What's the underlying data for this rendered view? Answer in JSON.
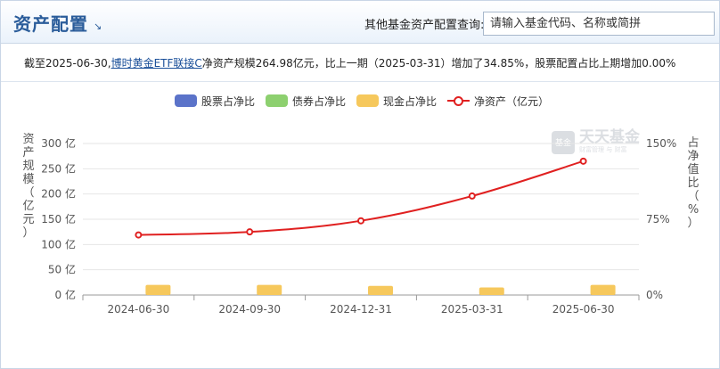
{
  "header": {
    "title": "资产配置",
    "title_arrow": "↘",
    "query_label": "其他基金资产配置查询:",
    "search_placeholder": "请输入基金代码、名称或简拼"
  },
  "summary": {
    "prefix": "截至2025-06-30,",
    "fund_link": "博时黄金ETF联接C",
    "suffix": "净资产规模264.98亿元，比上一期（2025-03-31）增加了34.85%，股票配置占比上期增加0.00%"
  },
  "watermark": {
    "logo": "基金",
    "name": "天天基金",
    "tagline": "财富管理 与 财富"
  },
  "colors": {
    "stock": "#5b73c9",
    "bond": "#8dd06f",
    "cash": "#f6c85c",
    "net_assets": "#e02020"
  },
  "chart_data": {
    "type": "bar",
    "legend": [
      "股票占净比",
      "债券占净比",
      "现金占净比",
      "净资产（亿元）"
    ],
    "legend_position": "top-center",
    "left_axis_label": [
      "资",
      "产",
      "规",
      "模",
      "（",
      "亿",
      "元",
      "）"
    ],
    "right_axis_label": [
      "占",
      "净",
      "值",
      "比",
      "（",
      "%",
      "）"
    ],
    "categories": [
      "2024-06-30",
      "2024-09-30",
      "2024-12-31",
      "2025-03-31",
      "2025-06-30"
    ],
    "left_ticks": [
      "0 亿",
      "50 亿",
      "100 亿",
      "150 亿",
      "200 亿",
      "250 亿",
      "300 亿"
    ],
    "right_ticks": [
      "0%",
      "75%",
      "150%"
    ],
    "ylim_left": [
      0,
      300
    ],
    "ylim_right": [
      0,
      150
    ],
    "series": [
      {
        "name": "股票占净比",
        "kind": "bar",
        "axis": "right",
        "values": [
          0,
          0,
          0,
          0,
          0
        ]
      },
      {
        "name": "债券占净比",
        "kind": "bar",
        "axis": "right",
        "values": [
          0,
          0,
          0,
          0,
          0
        ]
      },
      {
        "name": "现金占净比",
        "kind": "bar",
        "axis": "right",
        "values": [
          10,
          10,
          9,
          7.5,
          10
        ]
      },
      {
        "name": "净资产（亿元）",
        "kind": "line",
        "axis": "left",
        "values": [
          119,
          125,
          147,
          196,
          265
        ]
      }
    ],
    "grid": true
  }
}
